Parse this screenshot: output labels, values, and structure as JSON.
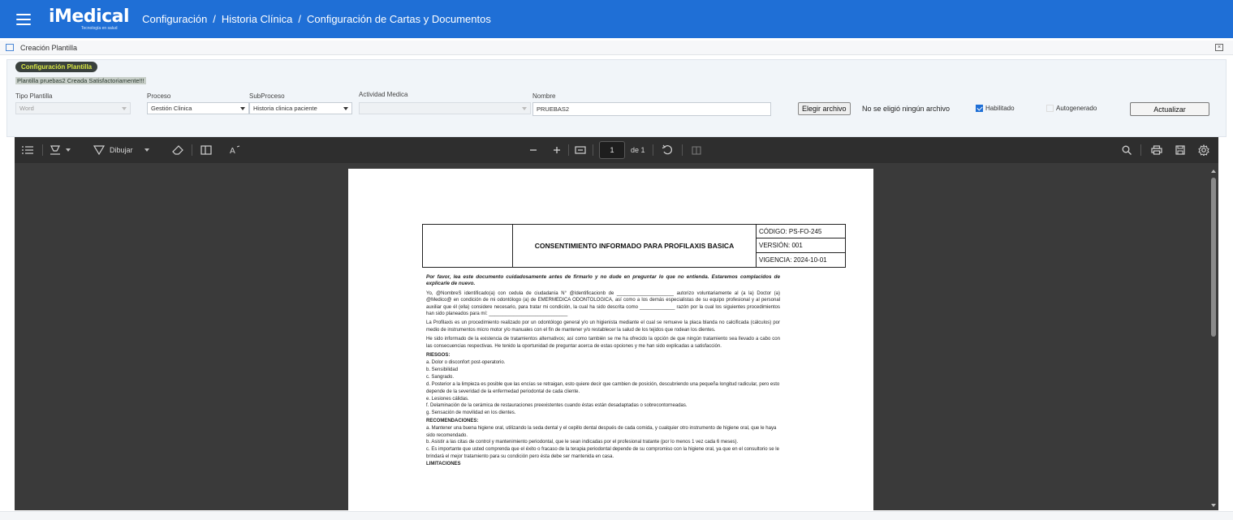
{
  "header": {
    "app_name": "iMedical",
    "tagline": "Tecnología en salud",
    "breadcrumb": [
      "Configuración",
      "Historia Clínica",
      "Configuración de Cartas y Documentos"
    ],
    "bg_color": "#1f6fd6"
  },
  "panel": {
    "title": "Creación Plantilla"
  },
  "config": {
    "badge": "Configuración Plantilla",
    "success_message": "Plantilla pruebas2 Creada Satisfactoriamente!!!",
    "fields": {
      "tipo_plantilla": {
        "label": "Tipo Plantilla",
        "value": "Word"
      },
      "proceso": {
        "label": "Proceso",
        "value": "Gestión Clinica"
      },
      "subproceso": {
        "label": "SubProceso",
        "value": "Historia clinica paciente"
      },
      "actividad_medica": {
        "label": "Actividad Medica",
        "value": ""
      },
      "nombre": {
        "label": "Nombre",
        "value": "PRUEBAS2"
      }
    },
    "file_button": "Elegir archivo",
    "file_status": "No se eligió ningún archivo",
    "habilitado": {
      "label": "Habilitado",
      "checked": true
    },
    "autogenerado": {
      "label": "Autogenerado",
      "checked": false
    },
    "update_button": "Actualizar"
  },
  "viewer": {
    "toolbar": {
      "draw_label": "Dibujar",
      "page_current": "1",
      "page_total": "de 1"
    }
  },
  "document": {
    "title": "CONSENTIMIENTO INFORMADO PARA PROFILAXIS BASICA",
    "code": "CÓDIGO: PS-FO-245",
    "version": "VERSIÓN:  001",
    "vigencia": "VIGENCIA: 2024-10-01",
    "intro": "Por favor, lea este documento cuidadosamente antes de firmarlo y no dude en preguntar lo que no entienda. Estaremos complacidos de explicarle de nuevo.",
    "p1": "Yo, @NombreS identificado(a) con cedula de ciudadanía N° @Identificacionb de _____________________ autorizo voluntariamente al (a la) Doctor (a) @Medico@ en condición de mi odontólogo (a) de EMERMEDICA ODONTOLOGICA, así como a los demás especialistas de su equipo profesional y al personal auxiliar que él (ella) considere necesario, para tratar mi condición, la cual ha sido descrita como _____________ razón por la cual los siguientes procedimientos han sido planeados para mí: _____________________________",
    "p2": "La Profilaxis es un procedimiento realizado por un odontólogo general y/o un higienista mediante el cual se remueve la placa blanda no calcificada (cálculos) por medio de instrumentos micro motor y/o manuales con el fin de mantener y/o restablecer la salud de los tejidos que rodean los dientes.",
    "p3": "He sido informado de la existencia de tratamientos alternativos; así como también se me ha ofrecido la opción de que ningún tratamiento sea llevado a cabo con las consecuencias respectivas. He tenido la oportunidad de preguntar acerca de estas opciones y me han sido explicadas a satisfacción.",
    "riesgos_heading": "RIESGOS:",
    "riesgos": [
      "a.  Dolor o disconfort post-operatorio.",
      "b.  Sensibilidad",
      "c.  Sangrado.",
      "d. Posterior a la limpieza es posible que las encías se retraigan, esto quiere decir que cambien de posición, descubriendo una pequeña longitud radicular, pero esto depende de la severidad de la enfermedad periodontal de cada cliente.",
      "e. Lesiones cálidas.",
      "f. Delaminación de la cerámica de restauraciones preexistentes cuando éstas están desadaptadas o sobrecontorneadas.",
      "g. Sensación de movilidad en los dientes."
    ],
    "recomendaciones_heading": "RECOMENDACIONES:",
    "recomendaciones": [
      "a.  Mantener una buena higiene oral, utilizando la seda dental y el cepillo dental después de cada comida, y cualquier otro instrumento de higiene oral, que le haya sido recomendado.",
      "b.  Asistir a las citas de control y mantenimiento periodontal, que le sean indicadas por el profesional tratante (por lo menos 1 vez cada 6 meses).",
      "c.  Es importante que usted comprenda que el éxito o fracaso de la terapia periodontal depende de su compromiso con la higiene oral, ya que en el consultorio se le brindará el mejor tratamiento para su condición pero ésta debe ser mantenida en casa."
    ],
    "limitaciones_heading": "LIMITACIONES"
  }
}
